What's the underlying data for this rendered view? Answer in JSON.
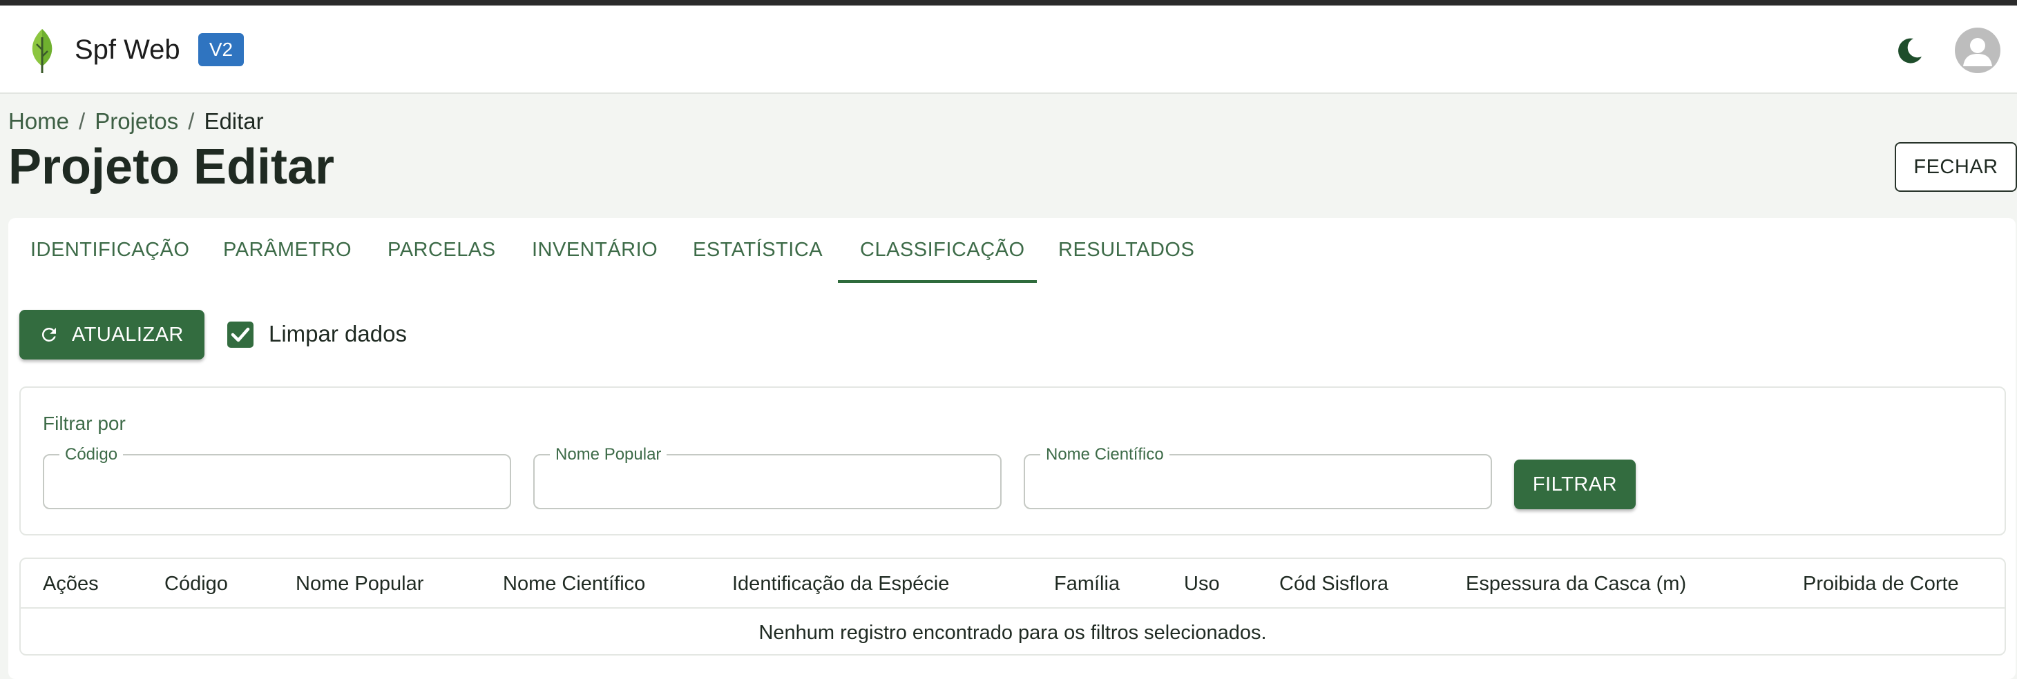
{
  "app": {
    "brand": "Spf Web",
    "version_badge": "V2",
    "icons": {
      "logo": "leaf-icon",
      "theme": "moon-icon",
      "avatar": "user-avatar-icon"
    }
  },
  "breadcrumb": {
    "items": [
      "Home",
      "Projetos",
      "Editar"
    ],
    "separator": "/"
  },
  "page": {
    "title": "Projeto Editar",
    "close_label": "FECHAR"
  },
  "tabs": {
    "items": [
      "IDENTIFICAÇÃO",
      "PARÂMETRO",
      "PARCELAS",
      "INVENTÁRIO",
      "ESTATÍSTICA",
      "CLASSIFICAÇÃO",
      "RESULTADOS"
    ],
    "active": "CLASSIFICAÇÃO"
  },
  "toolbar": {
    "update_label": "ATUALIZAR",
    "clear_label": "Limpar dados",
    "clear_checked": true
  },
  "filter": {
    "title": "Filtrar por",
    "fields": [
      {
        "label": "Código",
        "value": ""
      },
      {
        "label": "Nome Popular",
        "value": ""
      },
      {
        "label": "Nome Científico",
        "value": ""
      }
    ],
    "button_label": "FILTRAR"
  },
  "table": {
    "columns": [
      "Ações",
      "Código",
      "Nome Popular",
      "Nome Científico",
      "Identificação da Espécie",
      "Família",
      "Uso",
      "Cód Sisflora",
      "Espessura da Casca (m)",
      "Proibida de Corte"
    ],
    "empty_message": "Nenhum registro encontrado para os filtros selecionados."
  },
  "colors": {
    "primary": "#336c3f",
    "accent_text": "#3d6b48",
    "badge": "#2f74c0"
  }
}
